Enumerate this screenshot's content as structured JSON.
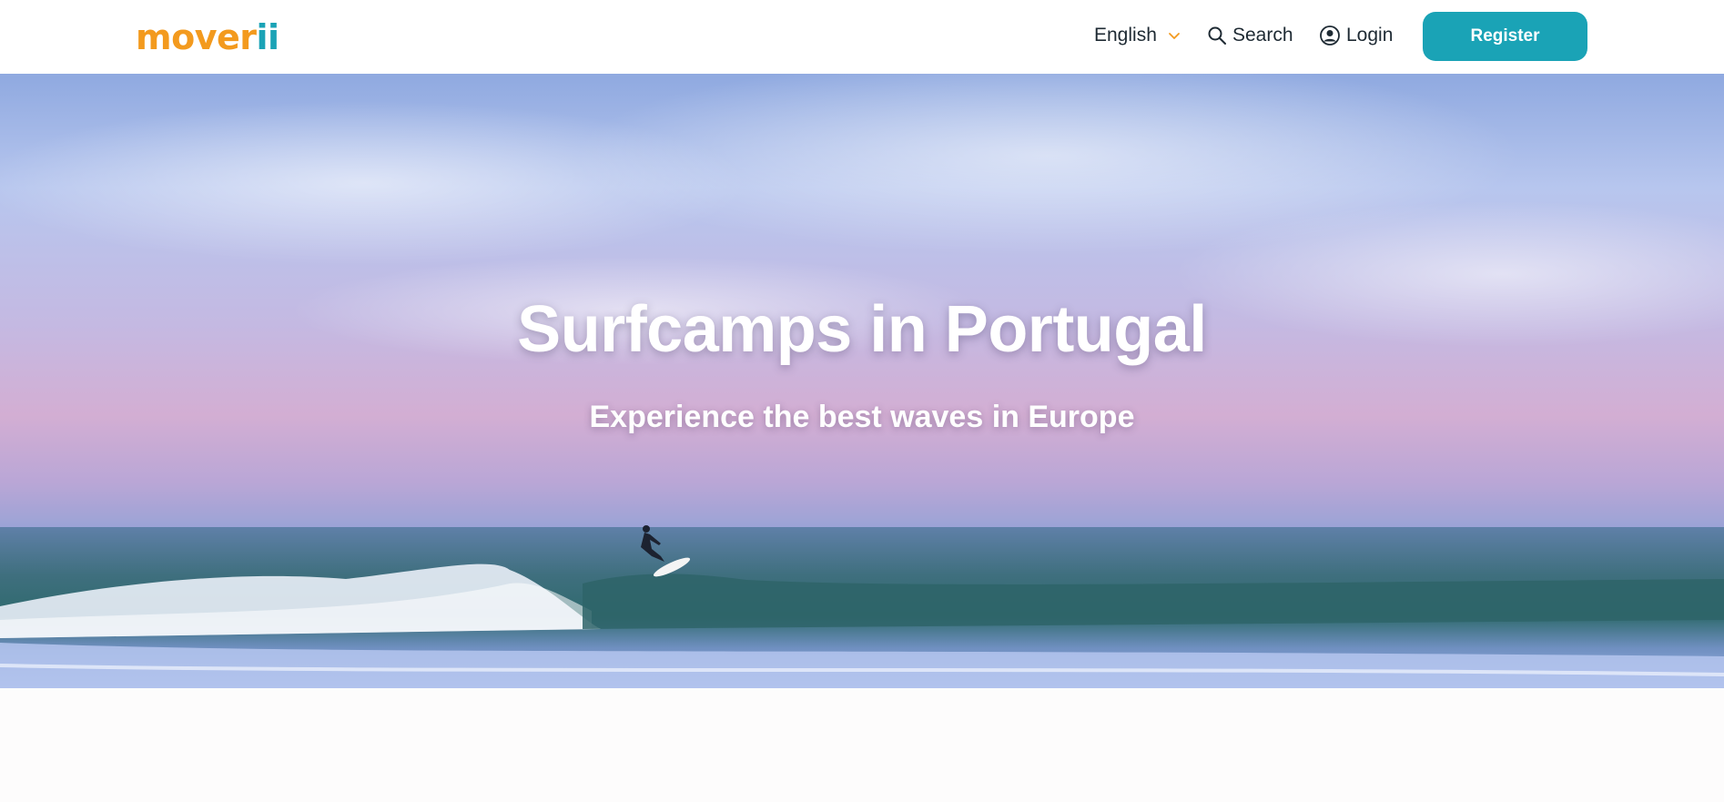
{
  "header": {
    "logo": {
      "part1": "mover",
      "part2": "ii"
    },
    "language": "English",
    "search_label": "Search",
    "login_label": "Login",
    "register_label": "Register"
  },
  "hero": {
    "title": "Surfcamps in Portugal",
    "subtitle": "Experience the best waves in Europe"
  },
  "colors": {
    "brand_orange": "#f39a1e",
    "brand_teal": "#1aa3b6"
  },
  "icons": {
    "language": "chevron-down-icon",
    "search": "search-icon",
    "login": "user-circle-icon"
  }
}
